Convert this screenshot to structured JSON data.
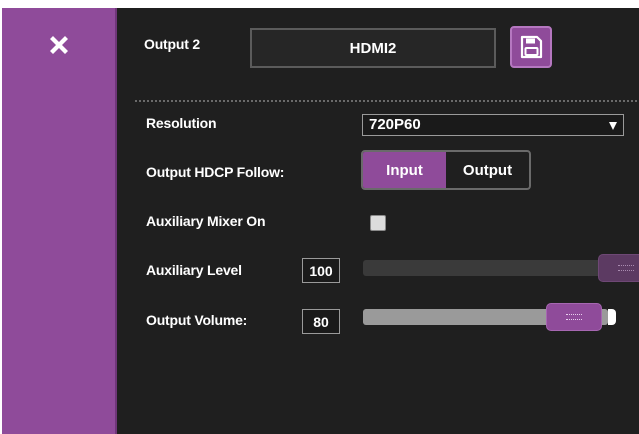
{
  "header": {
    "output_label": "Output 2",
    "output_name": "HDMI2"
  },
  "resolution": {
    "label": "Resolution",
    "selected": "720P60"
  },
  "hdcp": {
    "label": "Output HDCP Follow:",
    "options": [
      "Input",
      "Output"
    ],
    "active": "Input"
  },
  "aux_mixer": {
    "label": "Auxiliary Mixer On",
    "checked": false
  },
  "aux_level": {
    "label": "Auxiliary Level",
    "value": "100",
    "fraction": 1.0
  },
  "output_volume": {
    "label": "Output Volume:",
    "value": "80",
    "fraction": 0.8
  },
  "icons": {
    "close": "close-icon",
    "save": "save-icon"
  },
  "colors": {
    "accent": "#8f4b9a",
    "background": "#1f1f1f"
  }
}
